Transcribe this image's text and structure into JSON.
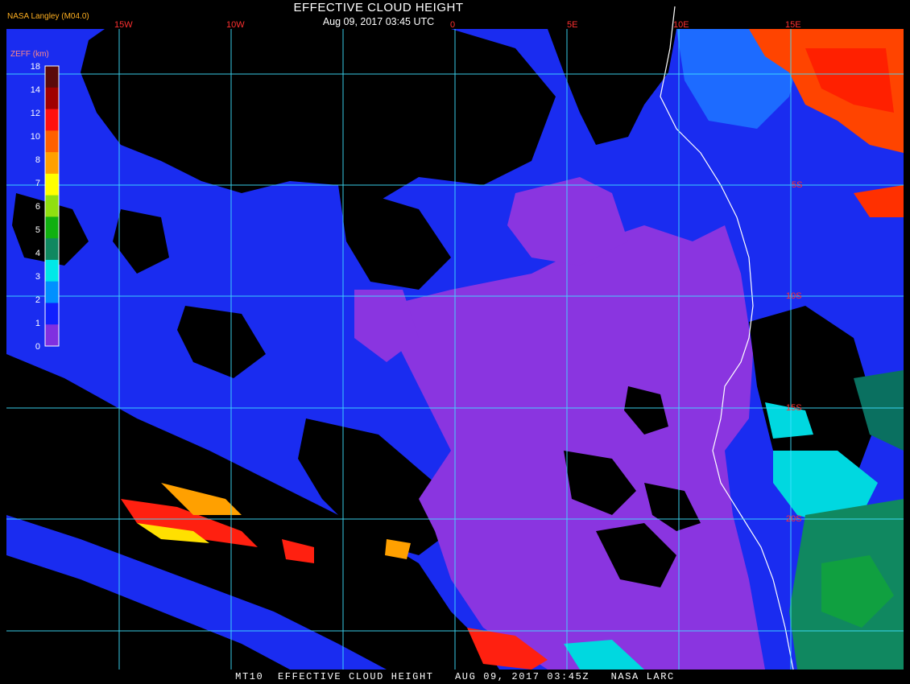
{
  "title": "EFFECTIVE CLOUD HEIGHT",
  "datetime": "Aug 09, 2017 03:45 UTC",
  "provider": "NASA Langley (M04.0)",
  "footer": "MT10  EFFECTIVE CLOUD HEIGHT   AUG 09, 2017 03:45Z   NASA LARC",
  "colorbar": {
    "label": "ZEFF (km)",
    "ticks": [
      "18",
      "14",
      "12",
      "10",
      "8",
      "7",
      "6",
      "5",
      "4",
      "3",
      "2",
      "1",
      "0"
    ],
    "colors": [
      "#5a0a0a",
      "#a00000",
      "#ff1010",
      "#ff6000",
      "#ffa000",
      "#ffff00",
      "#90e010",
      "#10b010",
      "#108860",
      "#00e8e8",
      "#0090ff",
      "#1020ff",
      "#8030e0"
    ]
  },
  "grid": {
    "lon_labels": [
      "15W",
      "10W",
      "0",
      "5E",
      "10E",
      "15E"
    ],
    "lat_labels": [
      "5S",
      "10S",
      "15S",
      "20S"
    ],
    "color": "#40e0ff"
  },
  "surface_colors": {
    "clear": "#000000",
    "low_cloud": "#1a2cf0",
    "stratocumulus": "#8a35e0",
    "mid_cloud": "#00e0e0",
    "high_cloud": "#ff4400",
    "coastline": "#ffffff"
  }
}
